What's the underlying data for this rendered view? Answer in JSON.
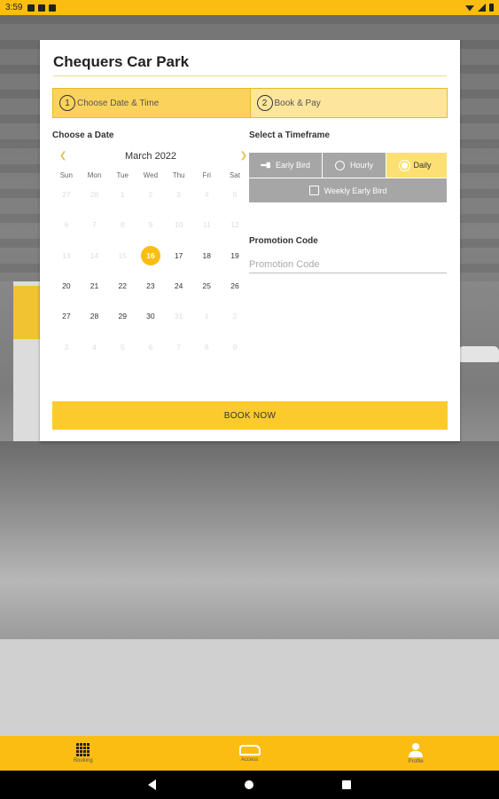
{
  "status_bar": {
    "time": "3:59"
  },
  "colors": {
    "accent": "#fbbd12",
    "step_active": "#fbd35c",
    "timeframe_active": "#fde073",
    "timeframe_inactive": "#a6a6a6"
  },
  "card": {
    "title": "Chequers Car Park"
  },
  "steps": [
    {
      "number": "1",
      "label": "Choose Date & Time",
      "active": true
    },
    {
      "number": "2",
      "label": "Book & Pay",
      "active": false
    }
  ],
  "calendar": {
    "section_label": "Choose a Date",
    "month_label": "March 2022",
    "prev_icon": "chevron-left-icon",
    "next_icon": "chevron-right-icon",
    "weekdays": [
      "Sun",
      "Mon",
      "Tue",
      "Wed",
      "Thu",
      "Fri",
      "Sat"
    ],
    "weeks": [
      [
        "27",
        "28",
        "1",
        "2",
        "3",
        "4",
        "5"
      ],
      [
        "6",
        "7",
        "8",
        "9",
        "10",
        "11",
        "12"
      ],
      [
        "13",
        "14",
        "15",
        "16",
        "17",
        "18",
        "19"
      ],
      [
        "20",
        "21",
        "22",
        "23",
        "24",
        "25",
        "26"
      ],
      [
        "27",
        "28",
        "29",
        "30",
        "31",
        "1",
        "2"
      ],
      [
        "3",
        "4",
        "5",
        "6",
        "7",
        "8",
        "9"
      ]
    ],
    "selected": "16"
  },
  "timeframe": {
    "section_label": "Select a Timeframe",
    "options": [
      {
        "label": "Early Bird",
        "icon": "key-icon",
        "active": false
      },
      {
        "label": "Hourly",
        "icon": "clock-icon",
        "active": false
      },
      {
        "label": "Daily",
        "icon": "sun-icon",
        "active": true
      },
      {
        "label": "Weekly Early Bird",
        "icon": "calendar-icon",
        "active": false
      }
    ]
  },
  "promotion": {
    "label": "Promotion Code",
    "placeholder": "Promotion Code",
    "value": ""
  },
  "book_now_label": "BOOK NOW",
  "bottom_nav": [
    {
      "label": "Booking",
      "icon": "calendar-icon"
    },
    {
      "label": "Access",
      "icon": "car-icon"
    },
    {
      "label": "Profile",
      "icon": "person-icon"
    }
  ]
}
